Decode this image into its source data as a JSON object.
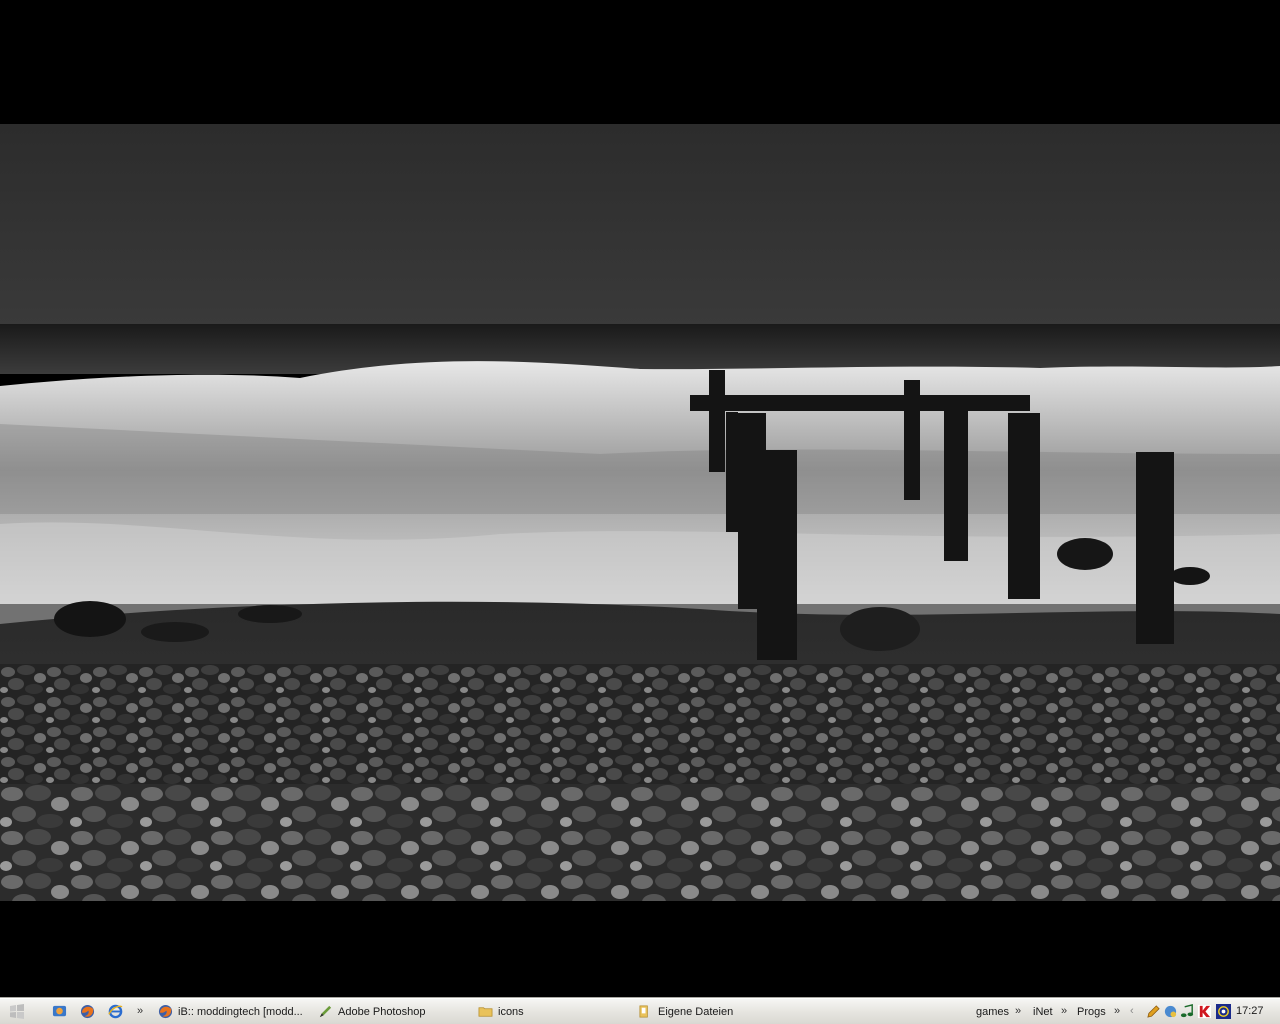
{
  "taskbar": {
    "quick_launch_more": "»",
    "windows": [
      {
        "label": "iB:: moddingtech [modd...",
        "icon": "firefox-icon"
      },
      {
        "label": "Adobe Photoshop",
        "icon": "photoshop-icon"
      },
      {
        "label": "icons",
        "icon": "folder-icon"
      },
      {
        "label": "Eigene Dateien",
        "icon": "documents-folder-icon"
      }
    ],
    "toolbars": [
      {
        "label": "games",
        "more": "»"
      },
      {
        "label": "iNet",
        "more": "»"
      },
      {
        "label": "Progs",
        "more": "»"
      }
    ],
    "tray_expand": "‹",
    "clock": "17:27"
  },
  "colors": {
    "taskbar_bg": "#e4e3de",
    "desktop_bg": "#000000"
  }
}
